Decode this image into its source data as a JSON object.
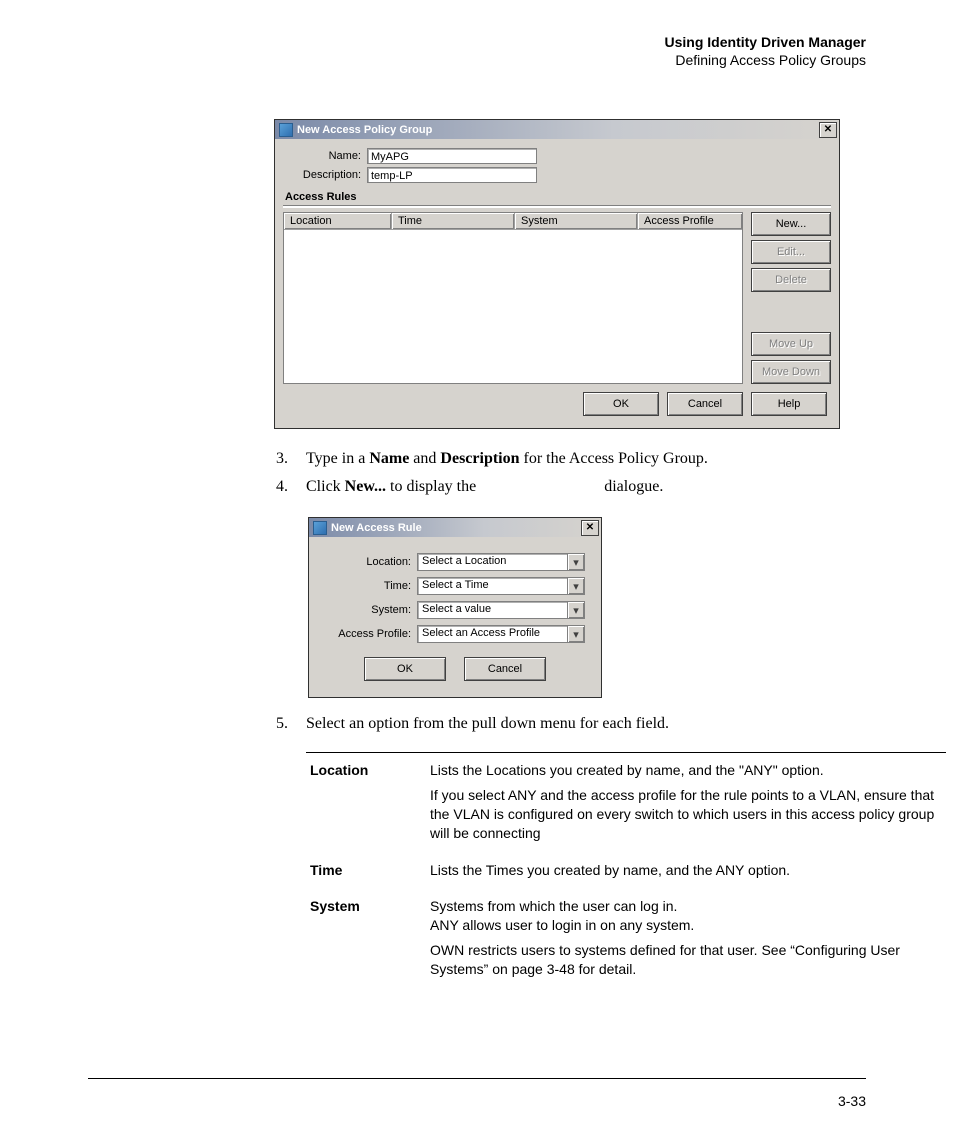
{
  "header": {
    "title": "Using Identity Driven Manager",
    "subtitle": "Defining Access Policy Groups"
  },
  "shot1": {
    "title": "New Access Policy Group",
    "close": "✕",
    "name_label": "Name:",
    "name_value": "MyAPG",
    "desc_label": "Description:",
    "desc_value": "temp-LP",
    "rules_label": "Access Rules",
    "cols": {
      "location": "Location",
      "time": "Time",
      "system": "System",
      "profile": "Access Profile"
    },
    "buttons": {
      "new": "New...",
      "edit": "Edit...",
      "delete": "Delete",
      "moveup": "Move Up",
      "movedown": "Move Down",
      "ok": "OK",
      "cancel": "Cancel",
      "help": "Help"
    }
  },
  "instr": {
    "i3_num": "3.",
    "i3_a": "Type in a ",
    "i3_b1": "Name",
    "i3_c": " and ",
    "i3_b2": "Description",
    "i3_d": " for the Access Policy Group.",
    "i4_num": "4.",
    "i4_a": "Click ",
    "i4_b": "New...",
    "i4_c": " to display the",
    "i4_d": "dialogue.",
    "i5_num": "5.",
    "i5_a": "Select an option from the pull down menu for each field."
  },
  "shot2": {
    "title": "New Access Rule",
    "close": "✕",
    "location_label": "Location:",
    "location_value": "Select a Location",
    "time_label": "Time:",
    "time_value": "Select a Time",
    "system_label": "System:",
    "system_value": "Select a value",
    "profile_label": "Access Profile:",
    "profile_value": "Select an Access Profile",
    "ok": "OK",
    "cancel": "Cancel",
    "arrow": "▾"
  },
  "defs": {
    "location_term": "Location",
    "location_p1": "Lists the Locations you created by name, and the \"ANY\" option.",
    "location_p2": "If you select ANY and the access profile for the rule points to a VLAN, ensure that the VLAN is configured on every switch to which users in this access policy group will be connecting",
    "time_term": "Time",
    "time_p1": "Lists the Times you created by name, and the ANY option.",
    "system_term": "System",
    "system_p1": "Systems from which the user can log in.\nANY allows user to login in on any system.",
    "system_p2": "OWN restricts users to systems defined for that user. See “Configuring User Systems” on page 3-48 for detail."
  },
  "page_number": "3-33"
}
